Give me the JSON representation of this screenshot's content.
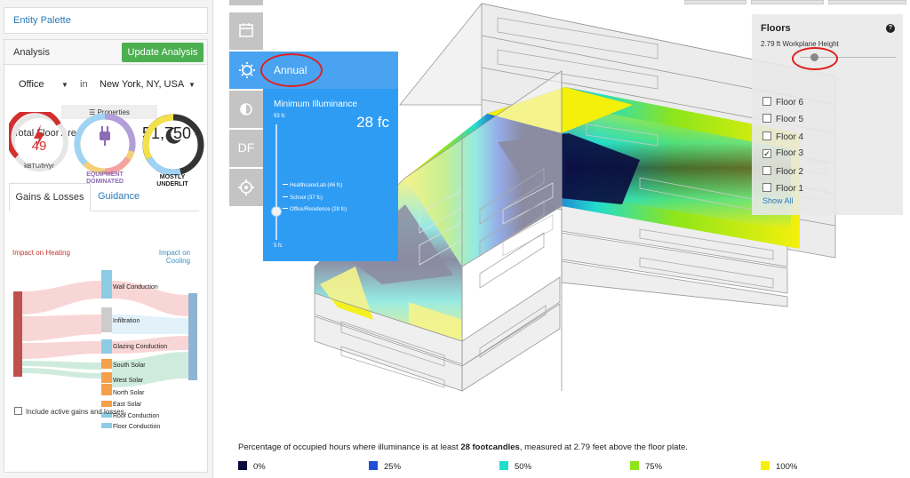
{
  "left_panel": {
    "entity_palette": "Entity Palette",
    "analysis_title": "Analysis",
    "update_button": "Update Analysis",
    "building_type": "Office",
    "in_word": "in",
    "location": "New York, NY, USA",
    "properties_button": "☰ Properties",
    "total_floor_area_label": "Total Floor Area",
    "total_floor_area_value": "51,750",
    "total_floor_area_unit": "ft²",
    "gauges": {
      "eui_value": "49",
      "eui_unit": "kBTU/ft²/yr",
      "load_label": "EQUIPMENT DOMINATED",
      "daylight_label": "MOSTLY UNDERLIT"
    },
    "tabs": {
      "gains_losses": "Gains & Losses",
      "guidance": "Guidance"
    },
    "impact_heating": "Impact on Heating",
    "impact_cooling": "Impact on Cooling",
    "sankey_items": [
      "Wall Conduction",
      "Infiltration",
      "Glazing Conduction",
      "South Solar",
      "West Solar",
      "North Solar",
      "East Solar",
      "Roof Conduction",
      "Floor Conduction"
    ],
    "include_active": "Include active gains and losses"
  },
  "popup": {
    "mode_label": "Annual",
    "min_illuminance_title": "Minimum Illuminance",
    "min_illuminance_value": "28 fc",
    "slider_max": "93 fc",
    "slider_min": "5 fc",
    "presets": [
      "Healthcare/Lab (46 fc)",
      "School (37 fc)",
      "Office/Residence (28 fc)"
    ]
  },
  "tools": {
    "df_label": "DF"
  },
  "floors_panel": {
    "title": "Floors",
    "help": "?",
    "workplane_label": "2.79 ft Workplane Height",
    "floors": [
      {
        "label": "Floor 6",
        "checked": false
      },
      {
        "label": "Floor 5",
        "checked": false
      },
      {
        "label": "Floor 4",
        "checked": false
      },
      {
        "label": "Floor 3",
        "checked": true
      },
      {
        "label": "Floor 2",
        "checked": false
      },
      {
        "label": "Floor 1",
        "checked": false
      }
    ],
    "show_all": "Show All"
  },
  "legend": {
    "caption_pre": "Percentage of occupied hours where illuminance is at least ",
    "caption_bold": "28 footcandles",
    "caption_post": ", measured at 2.79 feet above the floor plate.",
    "entries": [
      {
        "label": "0%",
        "color": "#0a0a3c"
      },
      {
        "label": "25%",
        "color": "#1f4fd8"
      },
      {
        "label": "50%",
        "color": "#22dccc"
      },
      {
        "label": "75%",
        "color": "#8ee51a"
      },
      {
        "label": "100%",
        "color": "#f4f00a"
      }
    ]
  },
  "colors": {
    "accent": "#4aa3f0",
    "update_green": "#4caf50",
    "annotation_red": "#e02020"
  }
}
